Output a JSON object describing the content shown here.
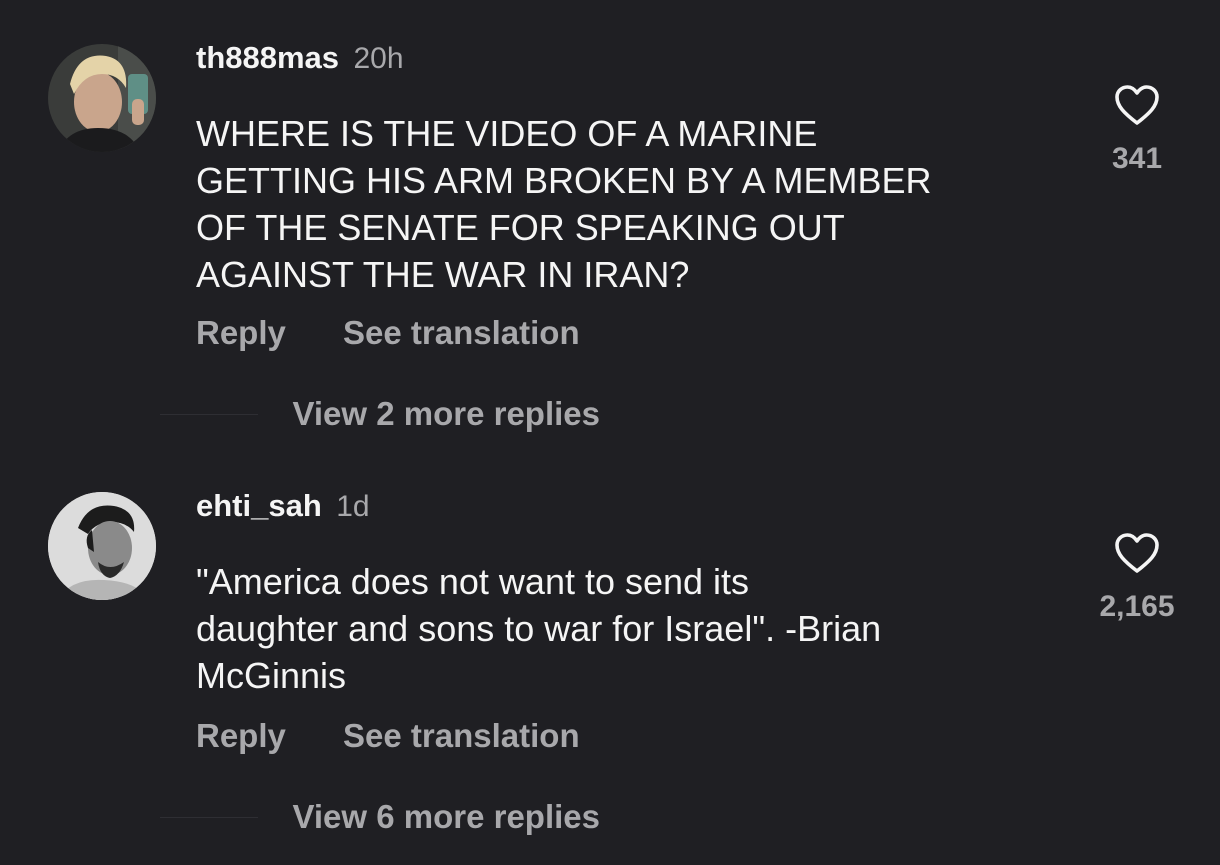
{
  "comments": [
    {
      "username": "th888mas",
      "time": "20h",
      "text_lines": [
        "WHERE IS THE VIDEO OF A MARINE",
        "GETTING HIS ARM BROKEN BY A MEMBER",
        "OF THE SENATE FOR SPEAKING OUT",
        "AGAINST THE WAR IN IRAN?"
      ],
      "reply_label": "Reply",
      "translate_label": "See translation",
      "likes": "341",
      "view_replies_label": "View 2 more replies",
      "avatar_icon": "user-photo-avatar"
    },
    {
      "username": "ehti_sah",
      "time": "1d",
      "text_lines": [
        "\"America does not want to send its",
        "daughter and sons to war for Israel\". -Brian",
        "McGinnis"
      ],
      "reply_label": "Reply",
      "translate_label": "See translation",
      "likes": "2,165",
      "view_replies_label": "View 6 more replies",
      "avatar_icon": "user-photo-avatar"
    }
  ],
  "colors": {
    "background": "#1f1f23",
    "primary_text": "#f5f5f5",
    "secondary_text": "#a8a8ab"
  },
  "icons": {
    "like": "heart-outline-icon"
  }
}
